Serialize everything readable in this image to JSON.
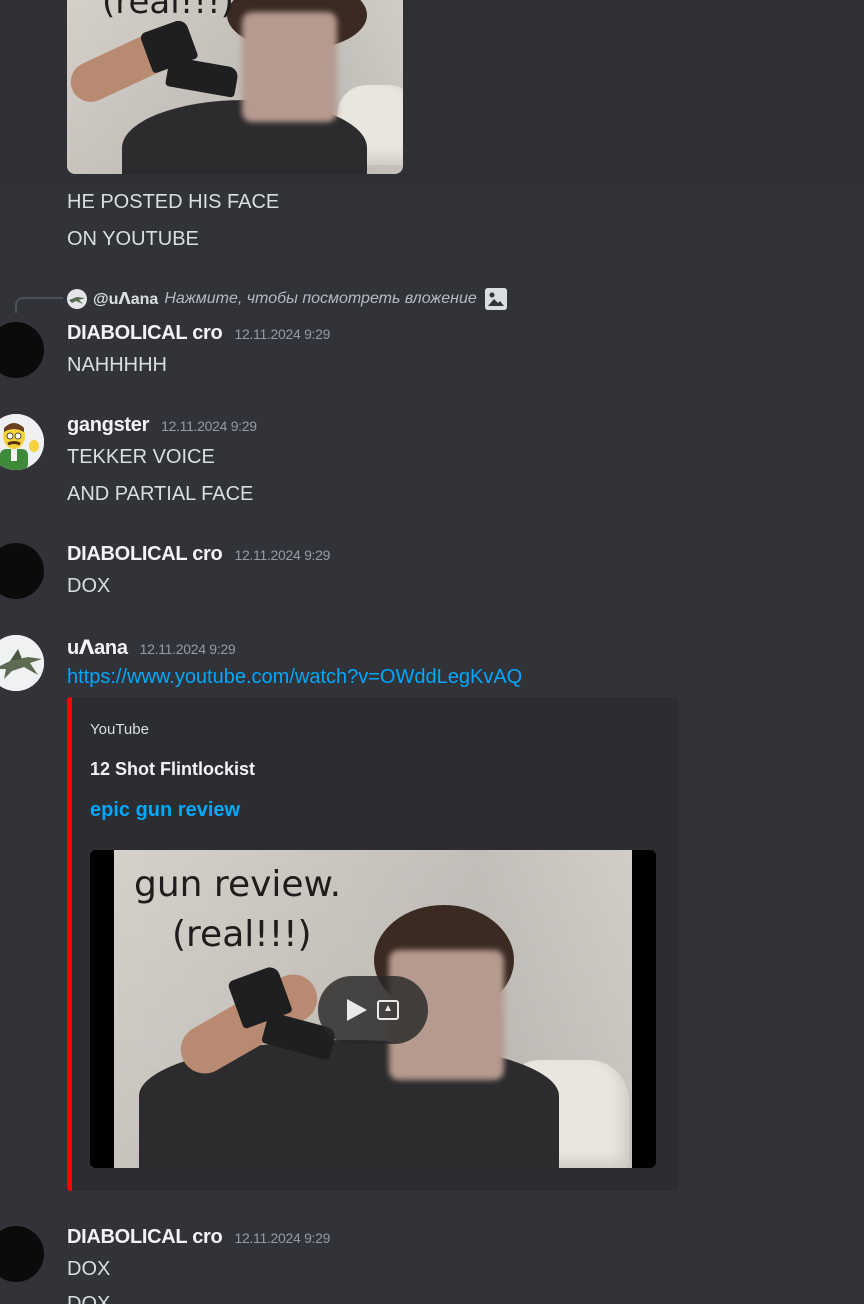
{
  "top_image": {
    "caption": "(real!!!)"
  },
  "messages": {
    "face_message": {
      "line1": "HE POSTED HIS FACE",
      "line2": "ON YOUTUBE"
    },
    "reply_preview": {
      "user": "@uᐱana",
      "text": "Нажмите, чтобы посмотреть вложение"
    },
    "msg1": {
      "username": "DIABOLICAL cro",
      "timestamp": "12.11.2024 9:29",
      "text": "NAHHHHH"
    },
    "msg2": {
      "username": "gangster",
      "timestamp": "12.11.2024 9:29",
      "line1": "TEKKER VOICE",
      "line2": "AND PARTIAL FACE"
    },
    "msg3": {
      "username": "DIABOLICAL cro",
      "timestamp": "12.11.2024 9:29",
      "text": "DOX"
    },
    "msg4": {
      "username": "uᐱana",
      "timestamp": "12.11.2024 9:29",
      "link": "https://www.youtube.com/watch?v=OWddLegKvAQ",
      "embed": {
        "provider": "YouTube",
        "title": "12 Shot Flintlockist",
        "description": "epic gun review",
        "thumbnail_caption_line1": "gun review.",
        "thumbnail_caption_line2": "(real!!!)",
        "accent_color": "#ff0000"
      }
    },
    "msg5": {
      "username": "DIABOLICAL cro",
      "timestamp": "12.11.2024 9:29",
      "line1": "DOX",
      "line2": "DOX"
    }
  },
  "icons": [
    "image-icon",
    "play-icon",
    "popout-icon"
  ]
}
